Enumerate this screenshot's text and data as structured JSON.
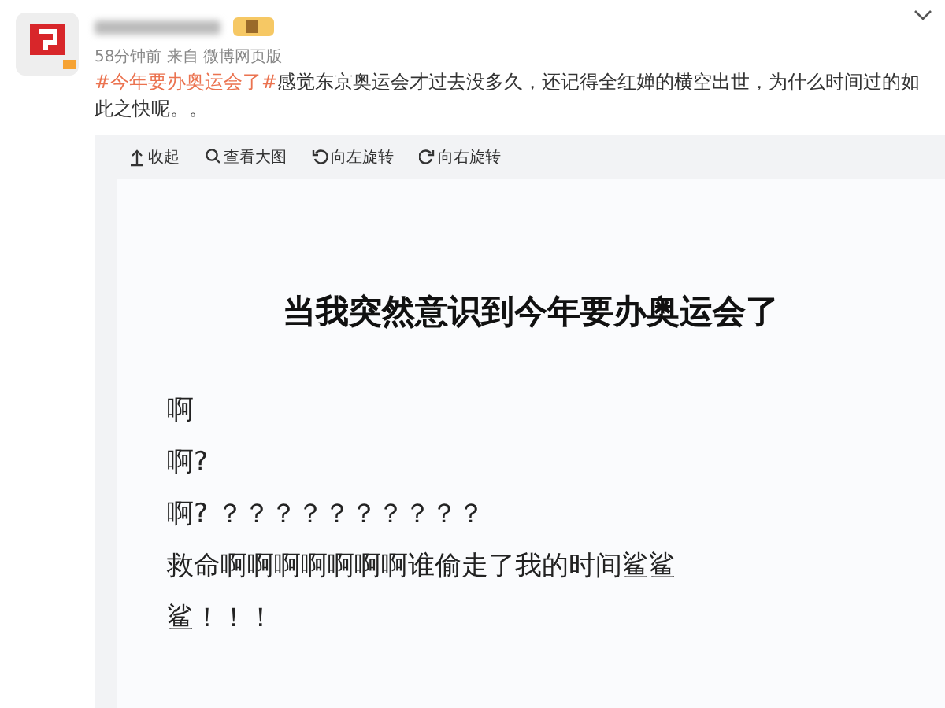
{
  "post": {
    "meta": "58分钟前  来自 微博网页版",
    "hashtag": "#今年要办奥运会了#",
    "text": "感觉东京奥运会才过去没多久，还记得全红婵的横空出世，为什么时间过的如此之快呢。。"
  },
  "toolbar": [
    {
      "kind": "collapse",
      "label": "收起"
    },
    {
      "kind": "zoom",
      "label": "查看大图"
    },
    {
      "kind": "rotate_left",
      "label": "向左旋转"
    },
    {
      "kind": "rotate_right",
      "label": "向右旋转"
    }
  ],
  "image": {
    "title": "当我突然意识到今年要办奥运会了",
    "lines": [
      "啊",
      "啊?",
      "啊? ？？？？？？？？？？",
      "救命啊啊啊啊啊啊啊谁偷走了我的时间鲨鲨",
      "鲨！！！"
    ]
  }
}
